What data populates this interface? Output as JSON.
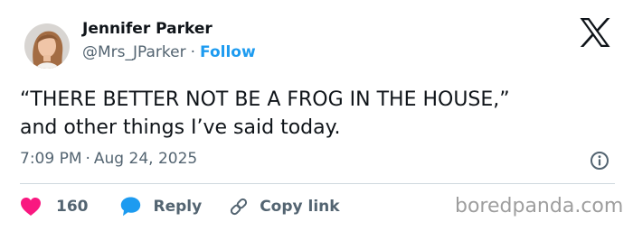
{
  "author": {
    "name": "Jennifer Parker",
    "handle": "@Mrs_JParker",
    "separator": "·",
    "follow_label": "Follow"
  },
  "tweet": {
    "lines": [
      "“THERE BETTER NOT BE A FROG IN THE HOUSE,”",
      "and other things I’ve said today."
    ],
    "time": "7:09 PM",
    "separator": "·",
    "date": "Aug 24, 2025"
  },
  "actions": {
    "like_count": "160",
    "reply_label": "Reply",
    "copy_link_label": "Copy link"
  },
  "watermark": "boredpanda.com",
  "icons": {
    "brand": "x-logo-icon",
    "like": "heart-icon",
    "reply": "speech-bubble-icon",
    "copy": "link-icon",
    "info": "info-icon"
  },
  "colors": {
    "text": "#0f1419",
    "secondary": "#536471",
    "accent": "#1d9bf0",
    "like": "#f91880",
    "divider": "#cfd9de",
    "watermark": "#9e9e9e"
  }
}
